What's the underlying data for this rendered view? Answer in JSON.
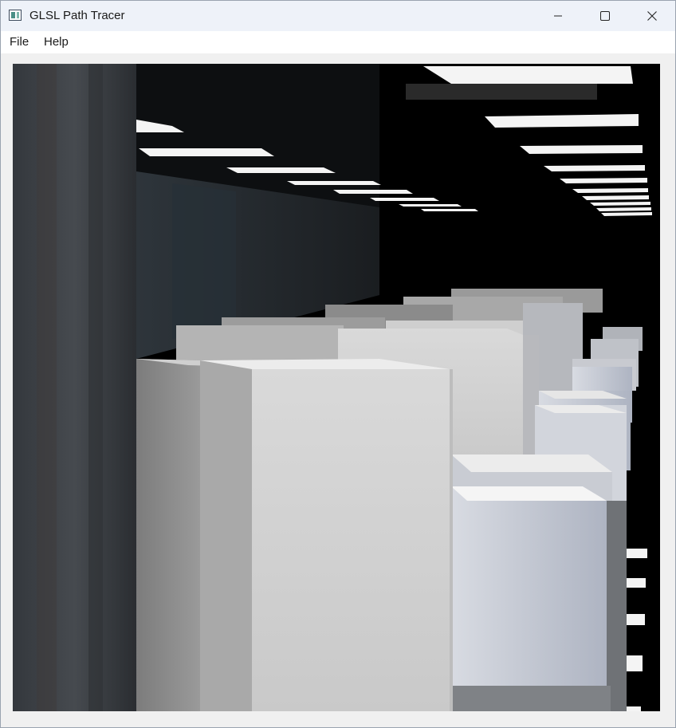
{
  "window": {
    "title": "GLSL Path Tracer",
    "controls": {
      "minimize_icon": "minimize-icon",
      "maximize_icon": "maximize-icon",
      "close_icon": "close-icon"
    }
  },
  "menubar": {
    "items": [
      {
        "label": "File"
      },
      {
        "label": "Help"
      }
    ]
  },
  "render": {
    "scene_icon": "rendered-scene",
    "colors": {
      "background": "#000000",
      "light": "#ffffff",
      "box_front": "#d6d6d6",
      "box_side": "#8d8d8d"
    }
  }
}
